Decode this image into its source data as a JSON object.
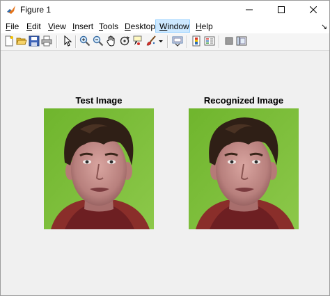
{
  "window": {
    "title": "Figure 1"
  },
  "menu": {
    "items": [
      {
        "first": "F",
        "rest": "ile"
      },
      {
        "first": "E",
        "rest": "dit"
      },
      {
        "first": "V",
        "rest": "iew"
      },
      {
        "first": "I",
        "rest": "nsert"
      },
      {
        "first": "T",
        "rest": "ools"
      },
      {
        "first": "D",
        "rest": "esktop"
      },
      {
        "first": "W",
        "rest": "indow"
      },
      {
        "first": "H",
        "rest": "elp"
      }
    ],
    "dock_glyph": "↘"
  },
  "toolbar": {
    "icons": [
      "new-figure-icon",
      "open-file-icon",
      "save-figure-icon",
      "print-icon",
      "edit-plot-arrow-icon",
      "zoom-in-icon",
      "zoom-out-icon",
      "pan-hand-icon",
      "rotate-3d-icon",
      "data-cursor-icon",
      "brush-icon",
      "brush-dropdown-icon",
      "link-plot-icon",
      "colorbar-icon",
      "legend-icon",
      "hide-plot-tools-icon",
      "show-plot-tools-icon"
    ]
  },
  "axes": [
    {
      "title": "Test Image"
    },
    {
      "title": "Recognized Image"
    }
  ],
  "colors": {
    "background": "#f0f0f0",
    "image_bg": "#7dbb3a",
    "menu_highlight": "#cce8ff"
  }
}
